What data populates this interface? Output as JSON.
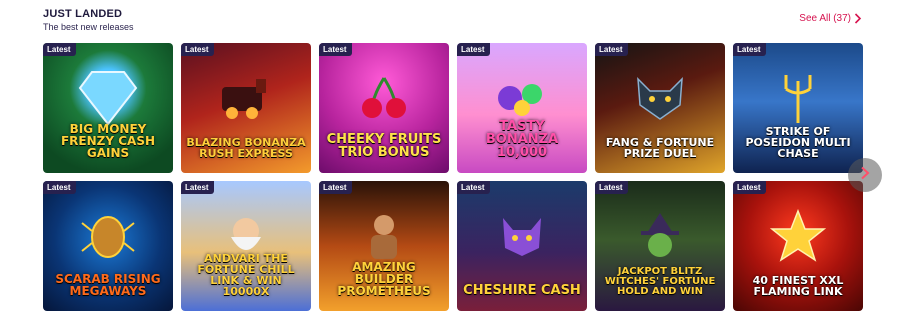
{
  "section": {
    "title": "JUST LANDED",
    "subtitle": "The best new releases",
    "see_all": "See All (37)"
  },
  "badge_label": "Latest",
  "colors": {
    "accent": "#d6134f",
    "badge_bg": "#27214f"
  },
  "games": [
    {
      "title": "BIG MONEY FRENZY CASH GAINS",
      "badge": "Latest",
      "title_color": "#ffd23a"
    },
    {
      "title": "BLAZING BONANZA RUSH EXPRESS",
      "badge": "Latest",
      "title_color": "#ffcf3a"
    },
    {
      "title": "CHEEKY FRUITS TRIO BONUS",
      "badge": "Latest",
      "title_color": "#ffe24a"
    },
    {
      "title": "TASTY BONANZA 10,000",
      "badge": "Latest",
      "title_color": "#ff4fa8"
    },
    {
      "title": "FANG & FORTUNE PRIZE DUEL",
      "badge": "Latest",
      "title_color": "#ffffff"
    },
    {
      "title": "STRIKE OF POSEIDON MULTI CHASE",
      "badge": "Latest",
      "title_color": "#ffffff"
    },
    {
      "title": "SCARAB RISING MEGAWAYS",
      "badge": "Latest",
      "title_color": "#ff6a1a"
    },
    {
      "title": "ANDVARI THE FORTUNE CHILL LINK & WIN 10000X",
      "badge": "Latest",
      "title_color": "#ffd23a"
    },
    {
      "title": "AMAZING BUILDER PROMETHEUS",
      "badge": "Latest",
      "title_color": "#ffd23a"
    },
    {
      "title": "CHESHIRE CASH",
      "badge": "Latest",
      "title_color": "#ffd23a"
    },
    {
      "title": "JACKPOT BLITZ WITCHES' FORTUNE HOLD AND WIN",
      "badge": "Latest",
      "title_color": "#ffd23a"
    },
    {
      "title": "40 FINEST XXL FLAMING LINK",
      "badge": "Latest",
      "title_color": "#ffffff"
    }
  ]
}
